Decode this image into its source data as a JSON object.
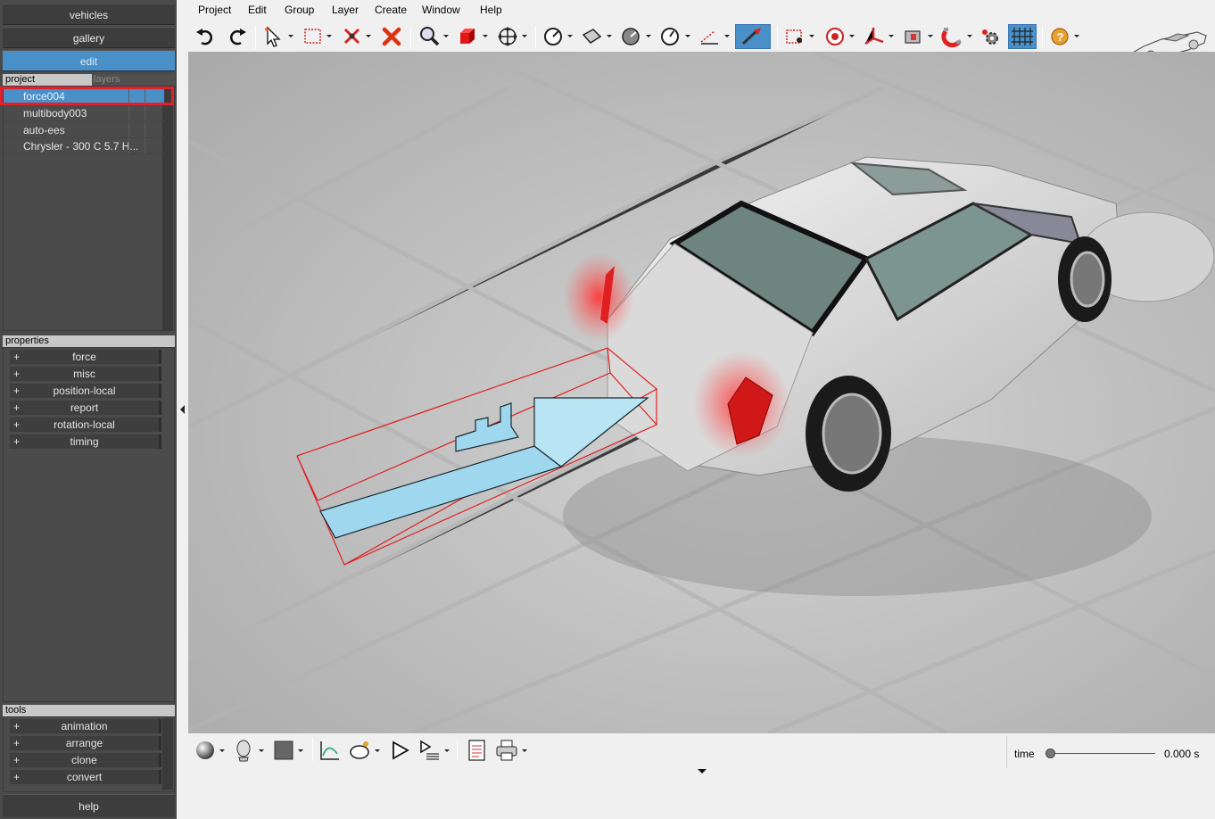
{
  "left_panel": {
    "modes": [
      "vehicles",
      "gallery",
      "edit"
    ],
    "active_mode": "edit",
    "project_tabs": {
      "project": "project",
      "layers": "layers"
    },
    "project_items": [
      "force004",
      "multibody003",
      "auto-ees",
      "Chrysler - 300 C 5.7 H..."
    ],
    "selected_item": "force004",
    "properties_title": "properties",
    "properties": [
      "force",
      "misc",
      "position-local",
      "report",
      "rotation-local",
      "timing"
    ],
    "tools_title": "tools",
    "tools": [
      "animation",
      "arrange",
      "clone",
      "convert"
    ],
    "help_label": "help",
    "plus": "+"
  },
  "menubar": [
    "Project",
    "Edit",
    "Group",
    "Layer",
    "Create",
    "Window",
    "Help"
  ],
  "toolbar": {
    "icons": [
      "undo-icon",
      "redo-icon",
      "select-arrow-icon",
      "select-rect-icon",
      "cut-joint-icon",
      "delete-icon",
      "zoom-icon",
      "box-primitive-icon",
      "move-gizmo-icon",
      "gauge-icon",
      "plane-icon",
      "dial-icon",
      "clock-icon",
      "measure-icon",
      "force-tool-icon",
      "camera-target-icon",
      "target-icon",
      "axes-icon",
      "light-icon",
      "magnet-icon",
      "settings-icon",
      "grid-icon",
      "help-icon"
    ],
    "active": "force-tool-icon"
  },
  "bottombar": {
    "icons": [
      "sphere-shading-icon",
      "head-view-icon",
      "color-swatch-icon",
      "graph-icon",
      "camera-rotate-icon",
      "play-icon",
      "playlist-icon",
      "notes-icon",
      "print-icon"
    ],
    "time_label": "time",
    "time_value": "0.000 s",
    "time_position": 0.0
  },
  "colors": {
    "panel_bg": "#4a4a4a",
    "selection_blue": "#4a90c8",
    "highlight_red": "#e0202a",
    "force_arrow": "#9fd8ee",
    "floor": "#c8c8c8"
  }
}
